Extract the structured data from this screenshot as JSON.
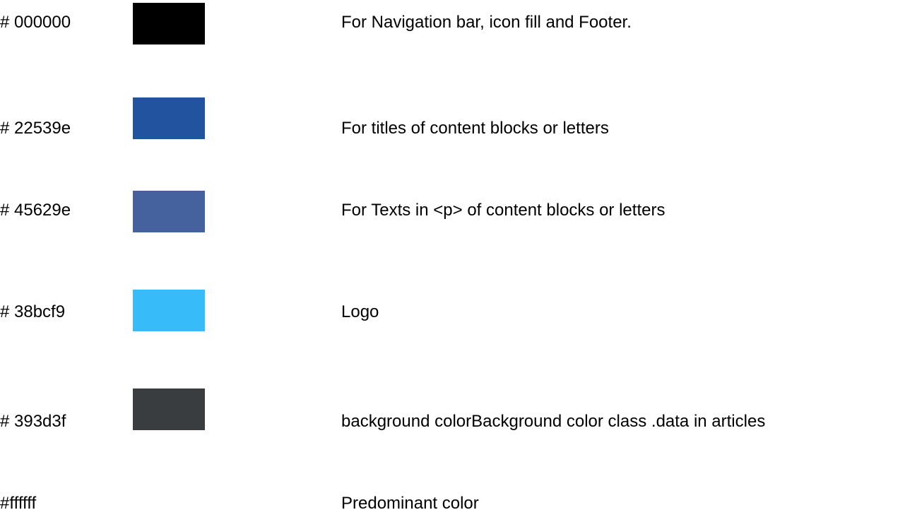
{
  "palette": [
    {
      "hex": "# 000000",
      "color": "#000000",
      "description": "For Navigation bar, icon fill and Footer."
    },
    {
      "hex": "# 22539e",
      "color": "#22539e",
      "description": "For titles of content blocks or letters"
    },
    {
      "hex": "# 45629e",
      "color": "#45629e",
      "description": "For Texts in <p> of content blocks or letters"
    },
    {
      "hex": "# 38bcf9",
      "color": "#38bcf9",
      "description": "Logo"
    },
    {
      "hex": "# 393d3f",
      "color": "#393d3f",
      "description": "background colorBackground color class .data in articles"
    },
    {
      "hex": "#ffffff",
      "color": "#ffffff",
      "description": "Predominant color"
    }
  ]
}
